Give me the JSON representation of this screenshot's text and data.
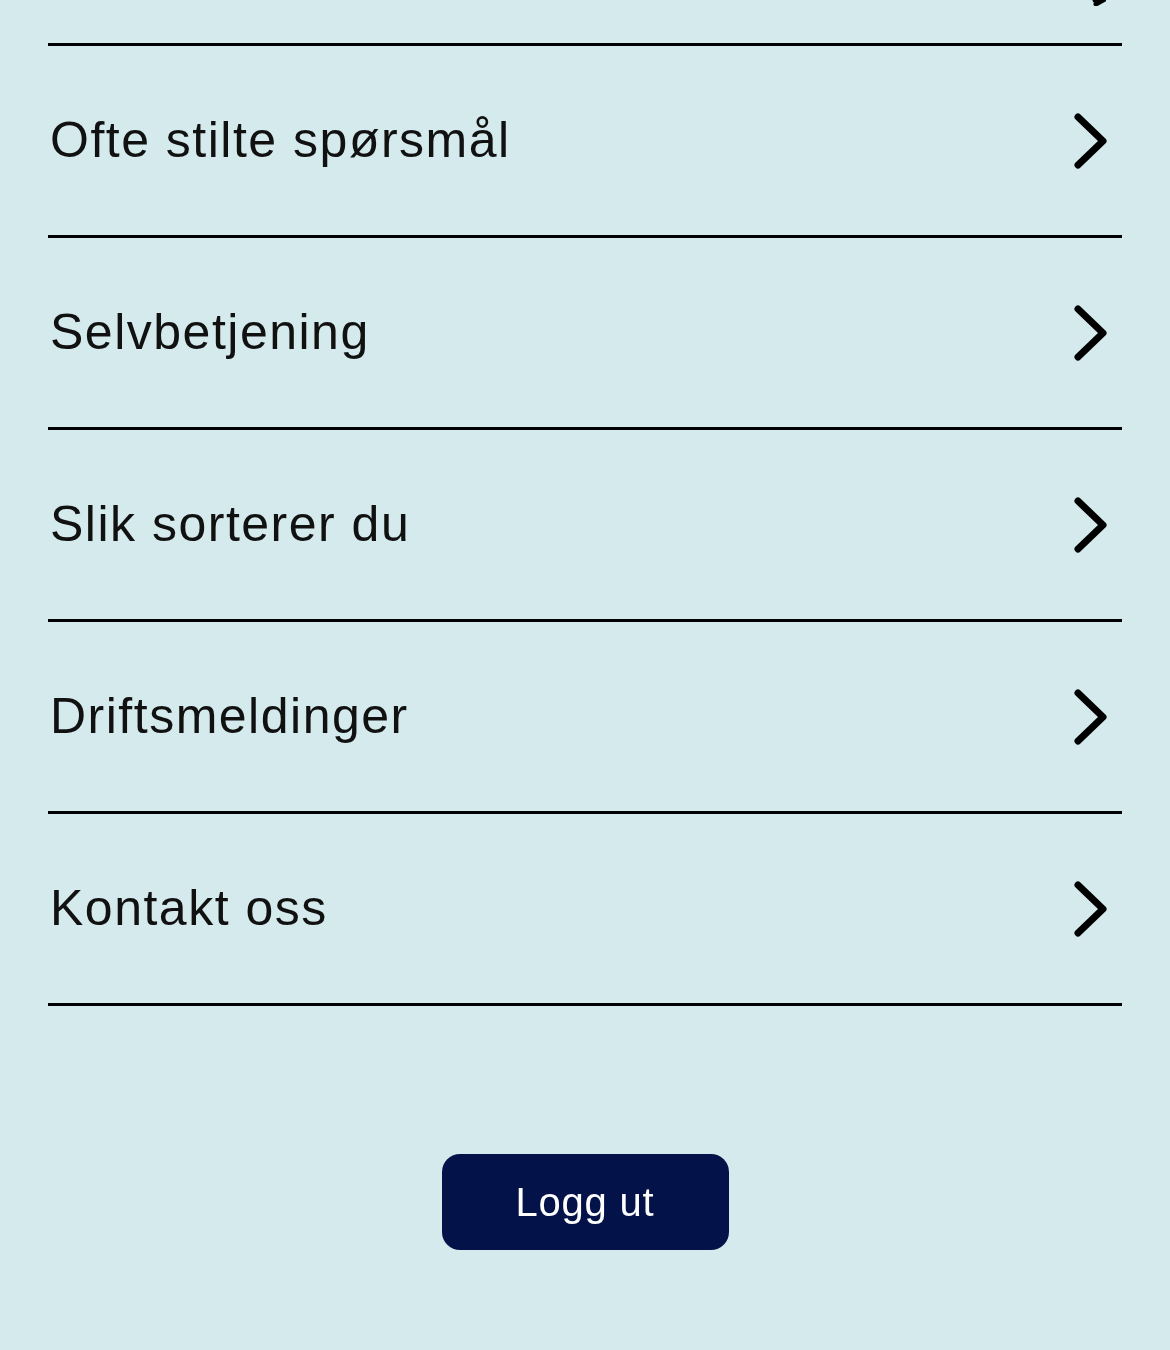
{
  "menu": [
    {
      "label": "Ofte stilte spørsmål"
    },
    {
      "label": "Selvbetjening"
    },
    {
      "label": "Slik sorterer du"
    },
    {
      "label": "Driftsmeldinger"
    },
    {
      "label": "Kontakt oss"
    }
  ],
  "logout_button": "Logg ut"
}
